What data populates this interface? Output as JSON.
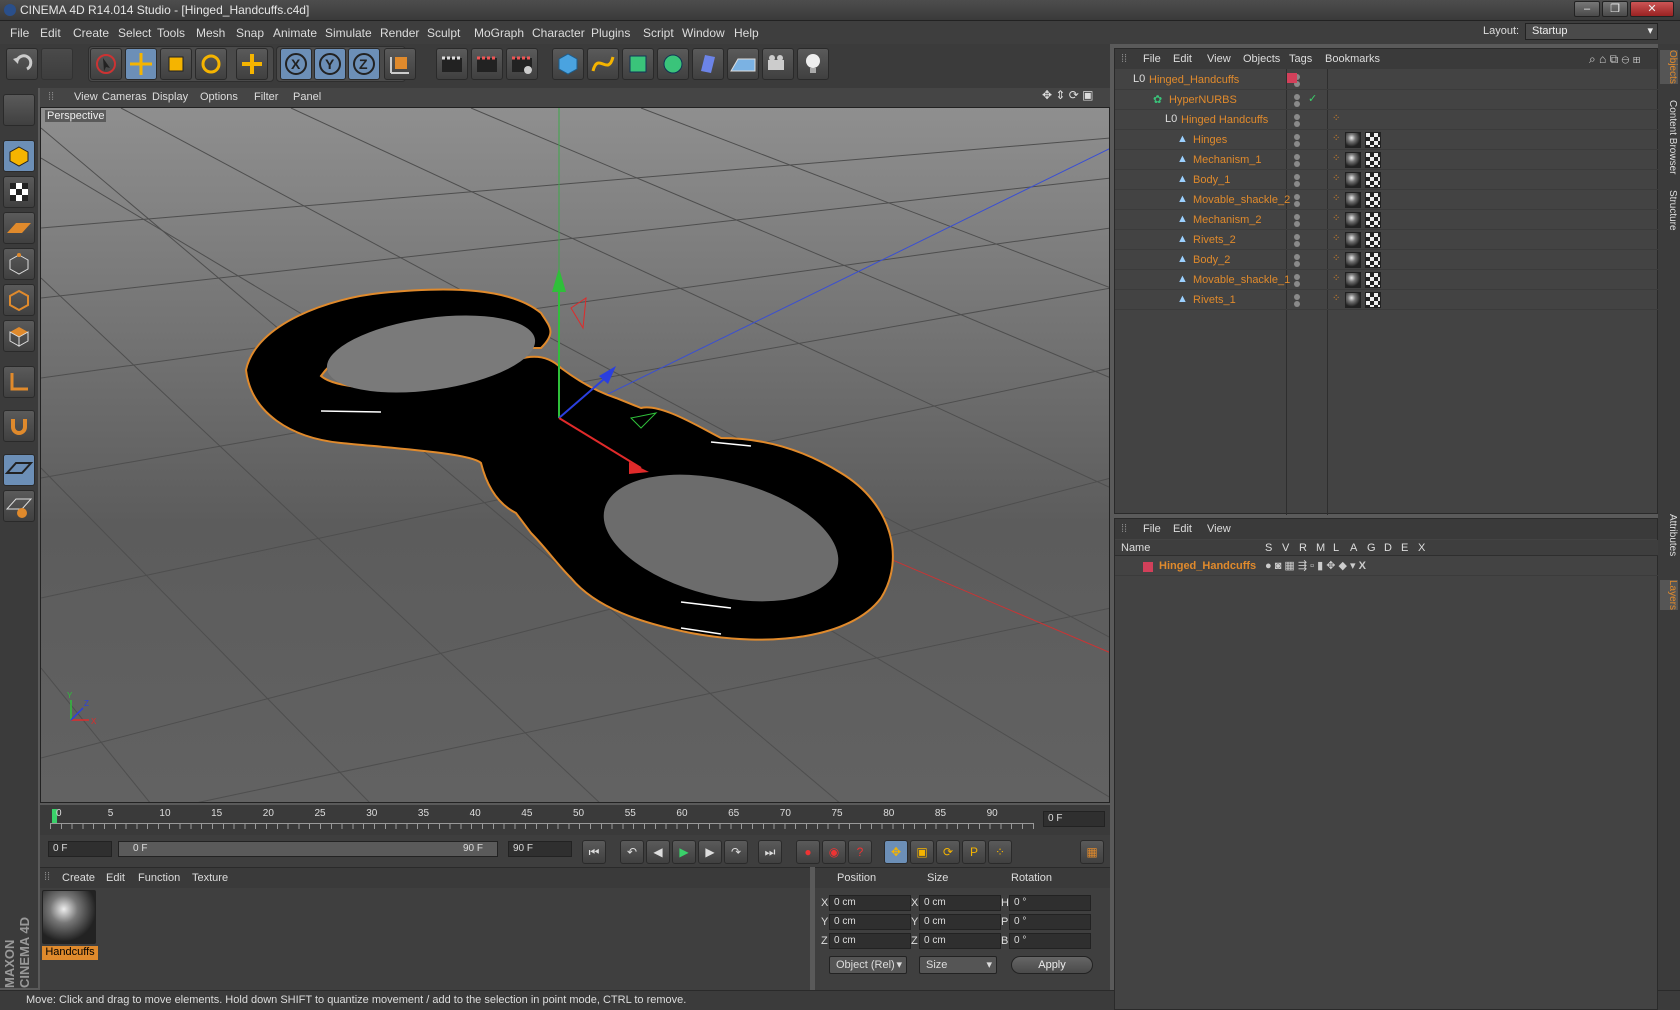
{
  "window": {
    "title": "CINEMA 4D R14.014 Studio - [Hinged_Handcuffs.c4d]",
    "layout_label": "Layout:",
    "layout_value": "Startup"
  },
  "menu": [
    "File",
    "Edit",
    "Create",
    "Select",
    "Tools",
    "Mesh",
    "Snap",
    "Animate",
    "Simulate",
    "Render",
    "Sculpt",
    "MoGraph",
    "Character",
    "Plugins",
    "Script",
    "Window",
    "Help"
  ],
  "viewport": {
    "menu": [
      "View",
      "Cameras",
      "Display",
      "Options",
      "Filter",
      "Panel"
    ],
    "label": "Perspective"
  },
  "timeline": {
    "ticks": [
      "0",
      "5",
      "10",
      "15",
      "20",
      "25",
      "30",
      "35",
      "40",
      "45",
      "50",
      "55",
      "60",
      "65",
      "70",
      "75",
      "80",
      "85",
      "90"
    ],
    "current_frame": "0 F"
  },
  "transport": {
    "start": "0 F",
    "range_start": "0 F",
    "range_end": "90 F",
    "end": "90 F"
  },
  "material_panel": {
    "menu": [
      "Create",
      "Edit",
      "Function",
      "Texture"
    ],
    "material_name": "Handcuffs"
  },
  "coords": {
    "headers": [
      "Position",
      "Size",
      "Rotation"
    ],
    "rows": [
      {
        "axis": "X",
        "pos": "0 cm",
        "sz_axis": "X",
        "size": "0 cm",
        "rot_axis": "H",
        "rot": "0 °"
      },
      {
        "axis": "Y",
        "pos": "0 cm",
        "sz_axis": "Y",
        "size": "0 cm",
        "rot_axis": "P",
        "rot": "0 °"
      },
      {
        "axis": "Z",
        "pos": "0 cm",
        "sz_axis": "Z",
        "size": "0 cm",
        "rot_axis": "B",
        "rot": "0 °"
      }
    ],
    "mode": "Object (Rel)",
    "size_mode": "Size",
    "apply": "Apply"
  },
  "objects": {
    "menu": [
      "File",
      "Edit",
      "View",
      "Objects",
      "Tags",
      "Bookmarks"
    ],
    "items": [
      {
        "name": "Hinged_Handcuffs"
      },
      {
        "name": "HyperNURBS"
      },
      {
        "name": "Hinged Handcuffs"
      },
      {
        "name": "Hinges"
      },
      {
        "name": "Mechanism_1"
      },
      {
        "name": "Body_1"
      },
      {
        "name": "Movable_shackle_2"
      },
      {
        "name": "Mechanism_2"
      },
      {
        "name": "Rivets_2"
      },
      {
        "name": "Body_2"
      },
      {
        "name": "Movable_shackle_1"
      },
      {
        "name": "Rivets_1"
      }
    ]
  },
  "layers": {
    "menu": [
      "File",
      "Edit",
      "View"
    ],
    "col_name": "Name",
    "cols": [
      "S",
      "V",
      "R",
      "M",
      "L",
      "A",
      "G",
      "D",
      "E",
      "X"
    ],
    "layer_name": "Hinged_Handcuffs"
  },
  "side_tabs": [
    "Objects",
    "Content Browser",
    "Structure",
    "Attributes",
    "Layers"
  ],
  "status": "Move: Click and drag to move elements. Hold down SHIFT to quantize movement / add to the selection in point mode, CTRL to remove.",
  "colors": {
    "accent": "#e08a2c",
    "bg": "#5a5a5a"
  }
}
